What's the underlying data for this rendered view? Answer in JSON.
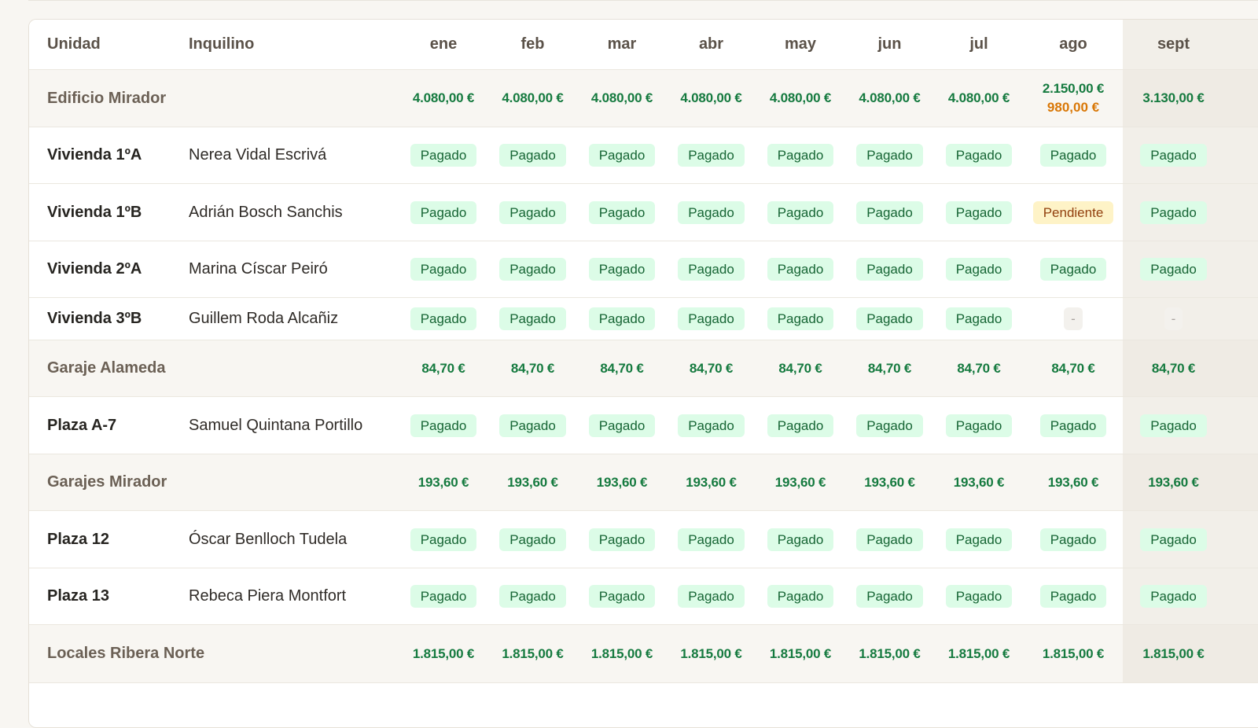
{
  "table": {
    "headers": {
      "unit": "Unidad",
      "tenant": "Inquilino",
      "months": [
        "ene",
        "feb",
        "mar",
        "abr",
        "may",
        "jun",
        "jul",
        "ago",
        "sept"
      ]
    },
    "current_month_index": 8
  },
  "colors": {
    "paid_badge_bg": "#dcfce7",
    "paid_badge_text": "#166534",
    "pending_badge_bg": "#fef3c7",
    "pending_badge_text": "#92400e",
    "amount_green": "#157a3f",
    "amount_orange": "#d97706"
  },
  "rows": [
    {
      "type": "group",
      "name": "Edificio Mirador",
      "totals": [
        {
          "paid": "4.080,00 €"
        },
        {
          "paid": "4.080,00 €"
        },
        {
          "paid": "4.080,00 €"
        },
        {
          "paid": "4.080,00 €"
        },
        {
          "paid": "4.080,00 €"
        },
        {
          "paid": "4.080,00 €"
        },
        {
          "paid": "4.080,00 €"
        },
        {
          "paid": "2.150,00 €",
          "pending": "980,00 €"
        },
        {
          "paid": "3.130,00 €"
        }
      ]
    },
    {
      "type": "unit",
      "unit": "Vivienda 1ºA",
      "tenant": "Nerea Vidal Escrivá",
      "statuses": [
        "Pagado",
        "Pagado",
        "Pagado",
        "Pagado",
        "Pagado",
        "Pagado",
        "Pagado",
        "Pagado",
        "Pagado"
      ]
    },
    {
      "type": "unit",
      "unit": "Vivienda 1ºB",
      "tenant": "Adrián Bosch Sanchis",
      "statuses": [
        "Pagado",
        "Pagado",
        "Pagado",
        "Pagado",
        "Pagado",
        "Pagado",
        "Pagado",
        "Pendiente",
        "Pagado"
      ]
    },
    {
      "type": "unit",
      "unit": "Vivienda 2ºA",
      "tenant": "Marina Císcar Peiró",
      "statuses": [
        "Pagado",
        "Pagado",
        "Pagado",
        "Pagado",
        "Pagado",
        "Pagado",
        "Pagado",
        "Pagado",
        "Pagado"
      ]
    },
    {
      "type": "unit",
      "unit": "Vivienda 3ºB",
      "tenant": "Guillem Roda Alcañiz",
      "statuses": [
        "Pagado",
        "Pagado",
        "Pagado",
        "Pagado",
        "Pagado",
        "Pagado",
        "Pagado",
        "-",
        "-"
      ]
    },
    {
      "type": "group",
      "name": "Garaje Alameda",
      "totals": [
        {
          "paid": "84,70 €"
        },
        {
          "paid": "84,70 €"
        },
        {
          "paid": "84,70 €"
        },
        {
          "paid": "84,70 €"
        },
        {
          "paid": "84,70 €"
        },
        {
          "paid": "84,70 €"
        },
        {
          "paid": "84,70 €"
        },
        {
          "paid": "84,70 €"
        },
        {
          "paid": "84,70 €"
        }
      ]
    },
    {
      "type": "unit",
      "unit": "Plaza A-7",
      "tenant": "Samuel Quintana Portillo",
      "statuses": [
        "Pagado",
        "Pagado",
        "Pagado",
        "Pagado",
        "Pagado",
        "Pagado",
        "Pagado",
        "Pagado",
        "Pagado"
      ]
    },
    {
      "type": "group",
      "name": "Garajes Mirador",
      "totals": [
        {
          "paid": "193,60 €"
        },
        {
          "paid": "193,60 €"
        },
        {
          "paid": "193,60 €"
        },
        {
          "paid": "193,60 €"
        },
        {
          "paid": "193,60 €"
        },
        {
          "paid": "193,60 €"
        },
        {
          "paid": "193,60 €"
        },
        {
          "paid": "193,60 €"
        },
        {
          "paid": "193,60 €"
        }
      ]
    },
    {
      "type": "unit",
      "unit": "Plaza 12",
      "tenant": "Óscar Benlloch Tudela",
      "statuses": [
        "Pagado",
        "Pagado",
        "Pagado",
        "Pagado",
        "Pagado",
        "Pagado",
        "Pagado",
        "Pagado",
        "Pagado"
      ]
    },
    {
      "type": "unit",
      "unit": "Plaza 13",
      "tenant": "Rebeca Piera Montfort",
      "statuses": [
        "Pagado",
        "Pagado",
        "Pagado",
        "Pagado",
        "Pagado",
        "Pagado",
        "Pagado",
        "Pagado",
        "Pagado"
      ]
    },
    {
      "type": "group",
      "name": "Locales Ribera Norte",
      "totals": [
        {
          "paid": "1.815,00 €"
        },
        {
          "paid": "1.815,00 €"
        },
        {
          "paid": "1.815,00 €"
        },
        {
          "paid": "1.815,00 €"
        },
        {
          "paid": "1.815,00 €"
        },
        {
          "paid": "1.815,00 €"
        },
        {
          "paid": "1.815,00 €"
        },
        {
          "paid": "1.815,00 €"
        },
        {
          "paid": "1.815,00 €"
        }
      ]
    }
  ]
}
